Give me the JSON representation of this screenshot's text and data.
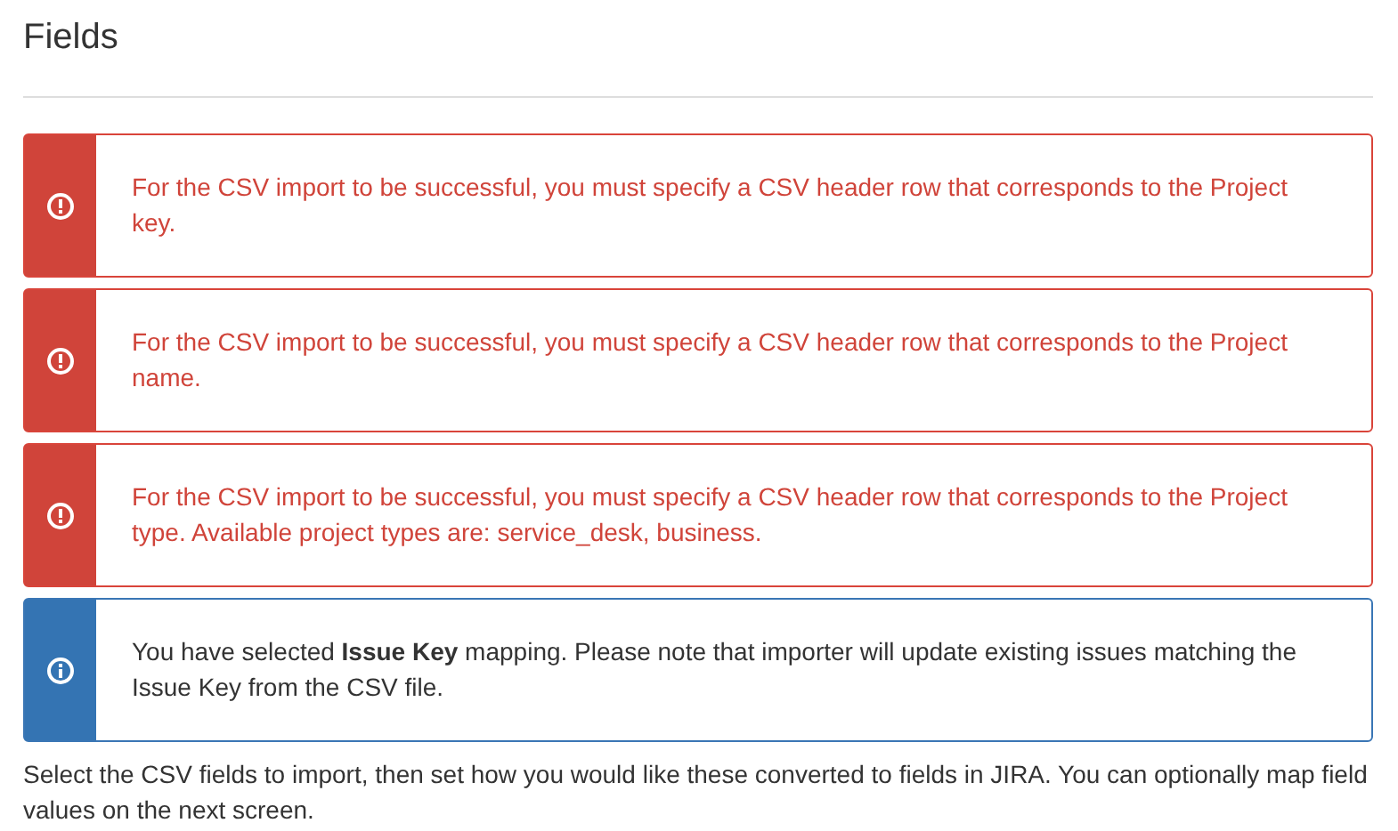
{
  "heading": "Fields",
  "alerts": [
    {
      "kind": "error",
      "text": "For the CSV import to be successful, you must specify a CSV header row that corresponds to the Project key."
    },
    {
      "kind": "error",
      "text": "For the CSV import to be successful, you must specify a CSV header row that corresponds to the Project name."
    },
    {
      "kind": "error",
      "text": "For the CSV import to be successful, you must specify a CSV header row that corresponds to the Project type. Available project types are: service_desk, business."
    },
    {
      "kind": "info",
      "text": "You have selected **Issue Key** mapping. Please note that importer will update existing issues matching the Issue Key from the CSV file."
    }
  ],
  "description": "Select the CSV fields to import, then set how you would like these converted to fields in JIRA. You can optionally map field values on the next screen."
}
